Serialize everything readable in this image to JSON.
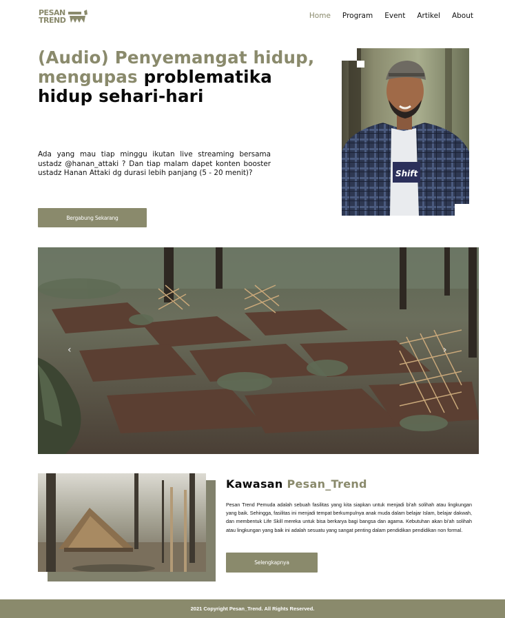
{
  "brand": {
    "logo_line1": "PESAN",
    "logo_line2": "TREND",
    "accent_color": "#8a8a6c"
  },
  "nav": {
    "items": [
      {
        "label": "Home",
        "active": true
      },
      {
        "label": "Program"
      },
      {
        "label": "Event"
      },
      {
        "label": "Artikel"
      },
      {
        "label": "About"
      }
    ]
  },
  "hero": {
    "title_accent": "(Audio) Penyemangat hidup, mengupas",
    "title_dark": "problematika hidup sehari-hari",
    "description": "Ada yang mau tiap minggu ikutan live streaming bersama ustadz @hanan_attaki ? Dan tiap malam dapet konten booster ustadz Hanan Attaki dg durasi lebih panjang (5 - 20 menit)?",
    "cta_label": "Bergabung Sekarang",
    "portrait_shirt_text": "Shift"
  },
  "carousel": {
    "prev_icon": "‹",
    "next_icon": "›"
  },
  "about": {
    "title_dark": "Kawasan",
    "title_accent": "Pesan_Trend",
    "description": "Pesan Trend Pemuda adalah sebuah fasilitas yang kita siapkan untuk menjadi bi'ah solihah atau lingkungan yang baik. Sehingga, fasilitas ini menjadi tempat berkumpulnya anak muda dalam belajar Islam, belajar dakwah, dan membentuk Life Skill mereka untuk bisa berkarya bagi bangsa dan agama. Kebutuhan akan bi'ah solihah atau lingkungan yang baik ini adalah sesuatu yang sangat penting dalam pendidikan pendidikan non formal.",
    "cta_label": "Selengkapnya"
  },
  "footer": {
    "copyright": "2021 Copyright Pesan_Trend. All Rights Reserved."
  }
}
